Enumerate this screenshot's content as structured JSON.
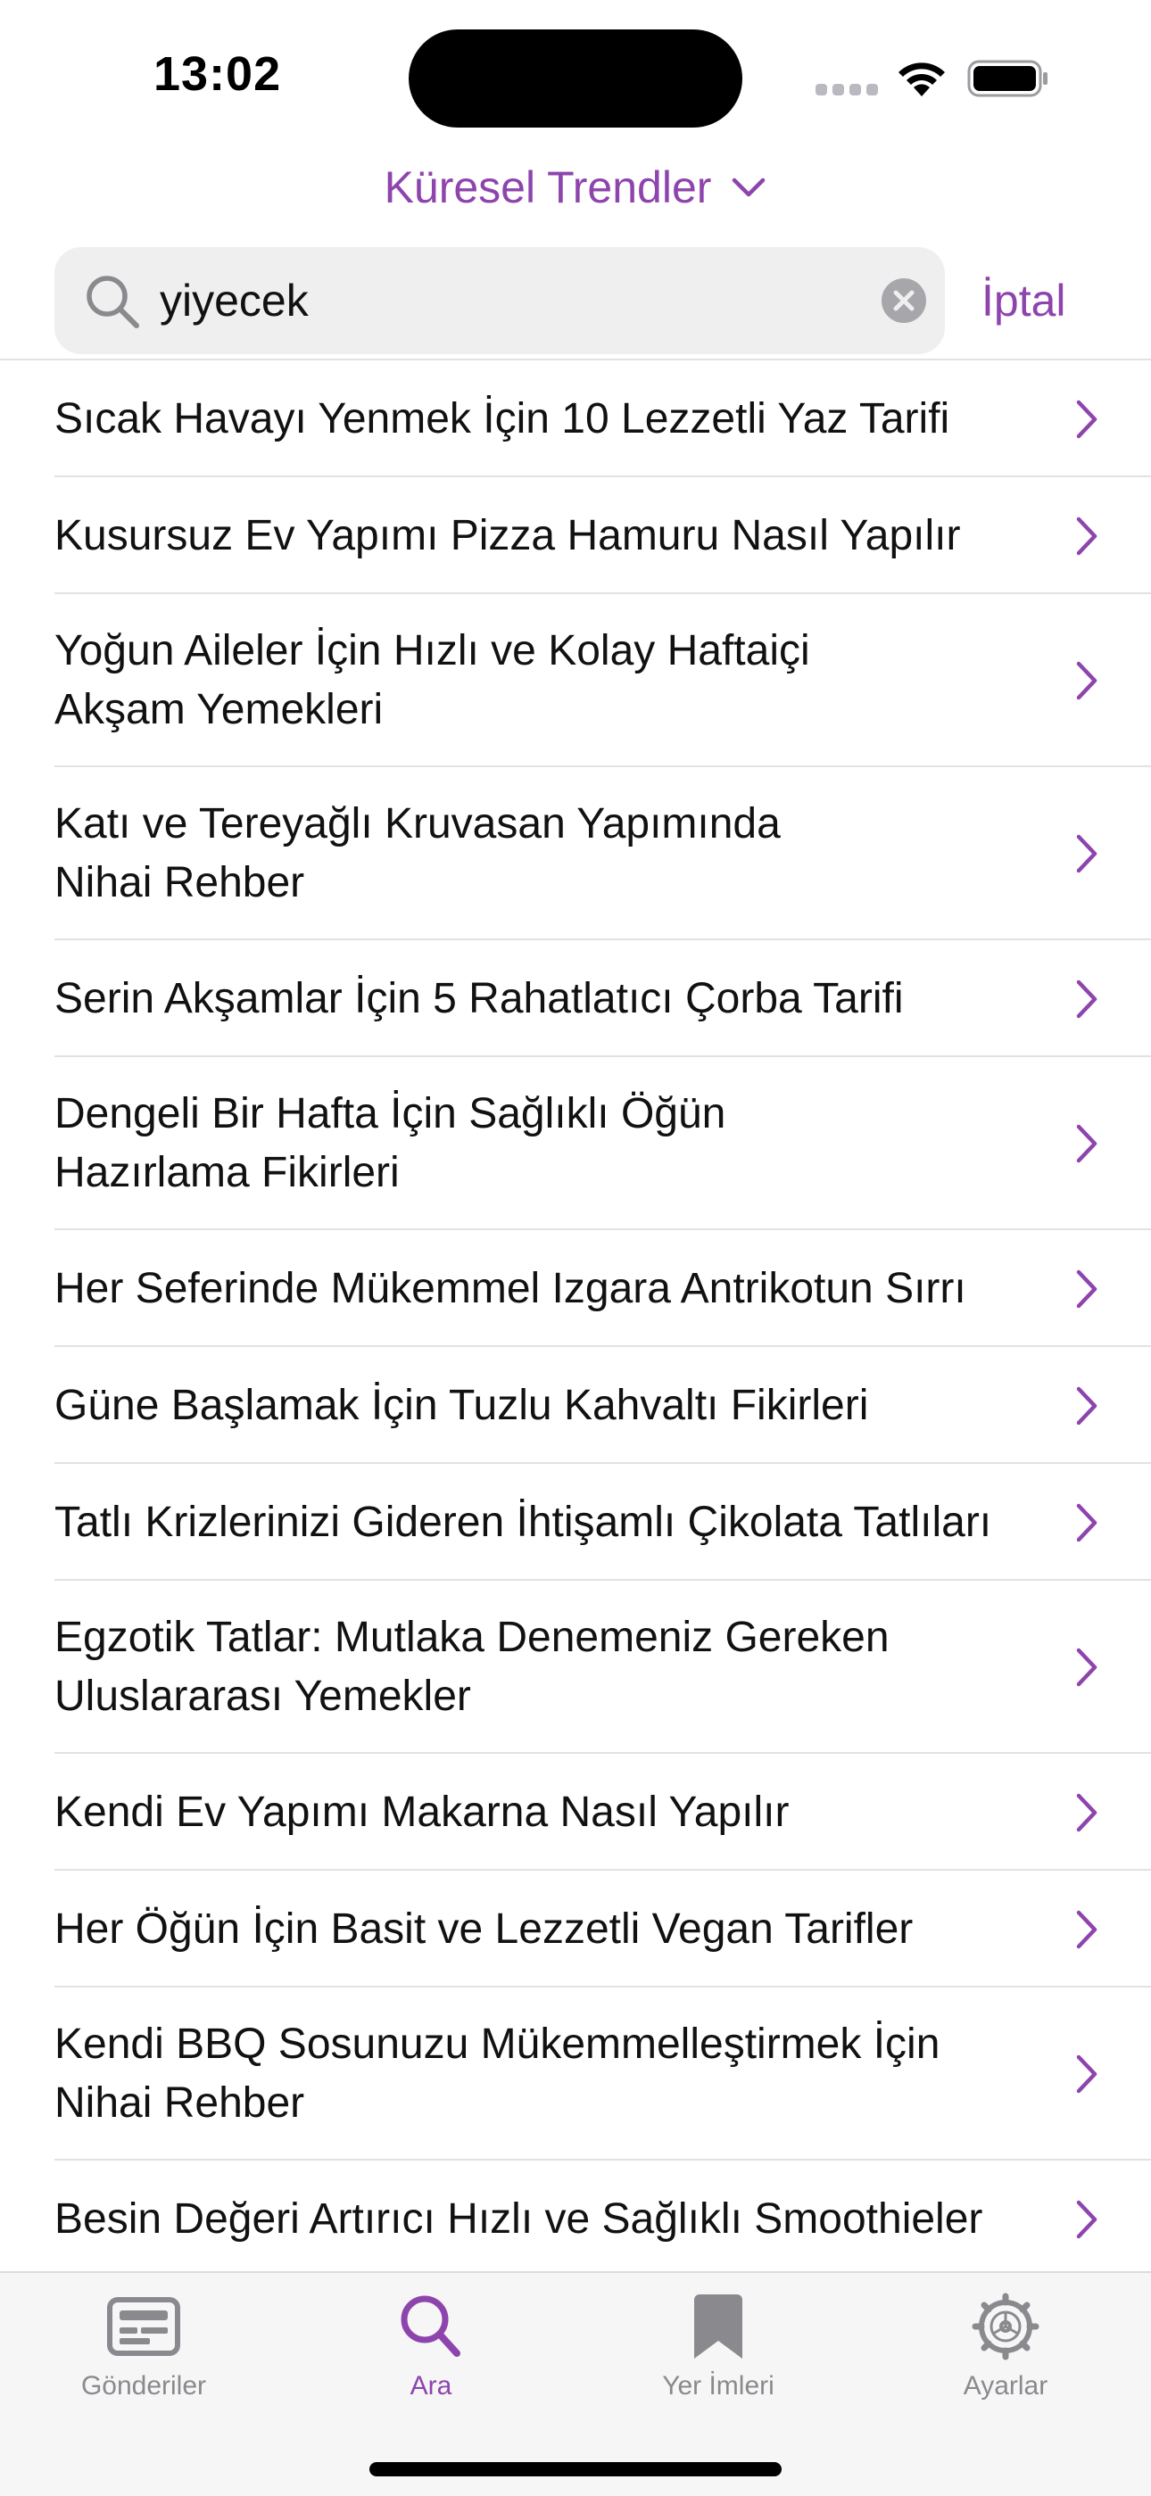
{
  "status_bar": {
    "time": "13:02",
    "icons": [
      "signal-icon",
      "wifi-icon",
      "battery-icon"
    ]
  },
  "header": {
    "feed_title": "Küresel Trendler",
    "dropdown_icon": "chevron-down-icon"
  },
  "search": {
    "value": "yiyecek",
    "placeholder": "",
    "cancel_label": "İptal"
  },
  "results": [
    "Sıcak Havayı Yenmek İçin 10 Lezzetli Yaz Tarifi",
    "Kusursuz Ev Yapımı Pizza Hamuru Nasıl Yapılır",
    "Yoğun Aileler İçin Hızlı ve Kolay Haftaiçi\nAkşam Yemekleri",
    "Katı ve Tereyağlı Kruvasan Yapımında\nNihai Rehber",
    "Serin Akşamlar İçin 5 Rahatlatıcı Çorba Tarifi",
    "Dengeli Bir Hafta İçin Sağlıklı Öğün\nHazırlama Fikirleri",
    "Her Seferinde Mükemmel Izgara Antrikotun Sırrı",
    "Güne Başlamak İçin Tuzlu Kahvaltı Fikirleri",
    "Tatlı Krizlerinizi Gideren İhtişamlı Çikolata Tatlıları",
    "Egzotik Tatlar: Mutlaka Denemeniz Gereken\nUluslararası Yemekler",
    "Kendi Ev Yapımı Makarna Nasıl Yapılır",
    "Her Öğün İçin Basit ve Lezzetli Vegan Tarifler",
    "Kendi BBQ Sosunuzu Mükemmelleştirmek İçin\nNihai Rehber",
    "Besin Değeri Artırıcı Hızlı ve Sağlıklı Smoothieler"
  ],
  "tab_bar": {
    "tabs": [
      {
        "label": "Gönderiler",
        "icon": "posts-icon",
        "active": false
      },
      {
        "label": "Ara",
        "icon": "search-icon",
        "active": true
      },
      {
        "label": "Yer İmleri",
        "icon": "bookmark-icon",
        "active": false
      },
      {
        "label": "Ayarlar",
        "icon": "settings-gear-icon",
        "active": false
      }
    ]
  },
  "colors": {
    "accent": "#8e44ad",
    "inactive": "#8a8a8e",
    "search_background": "#efeff0",
    "separator": "#e2e2e4"
  }
}
